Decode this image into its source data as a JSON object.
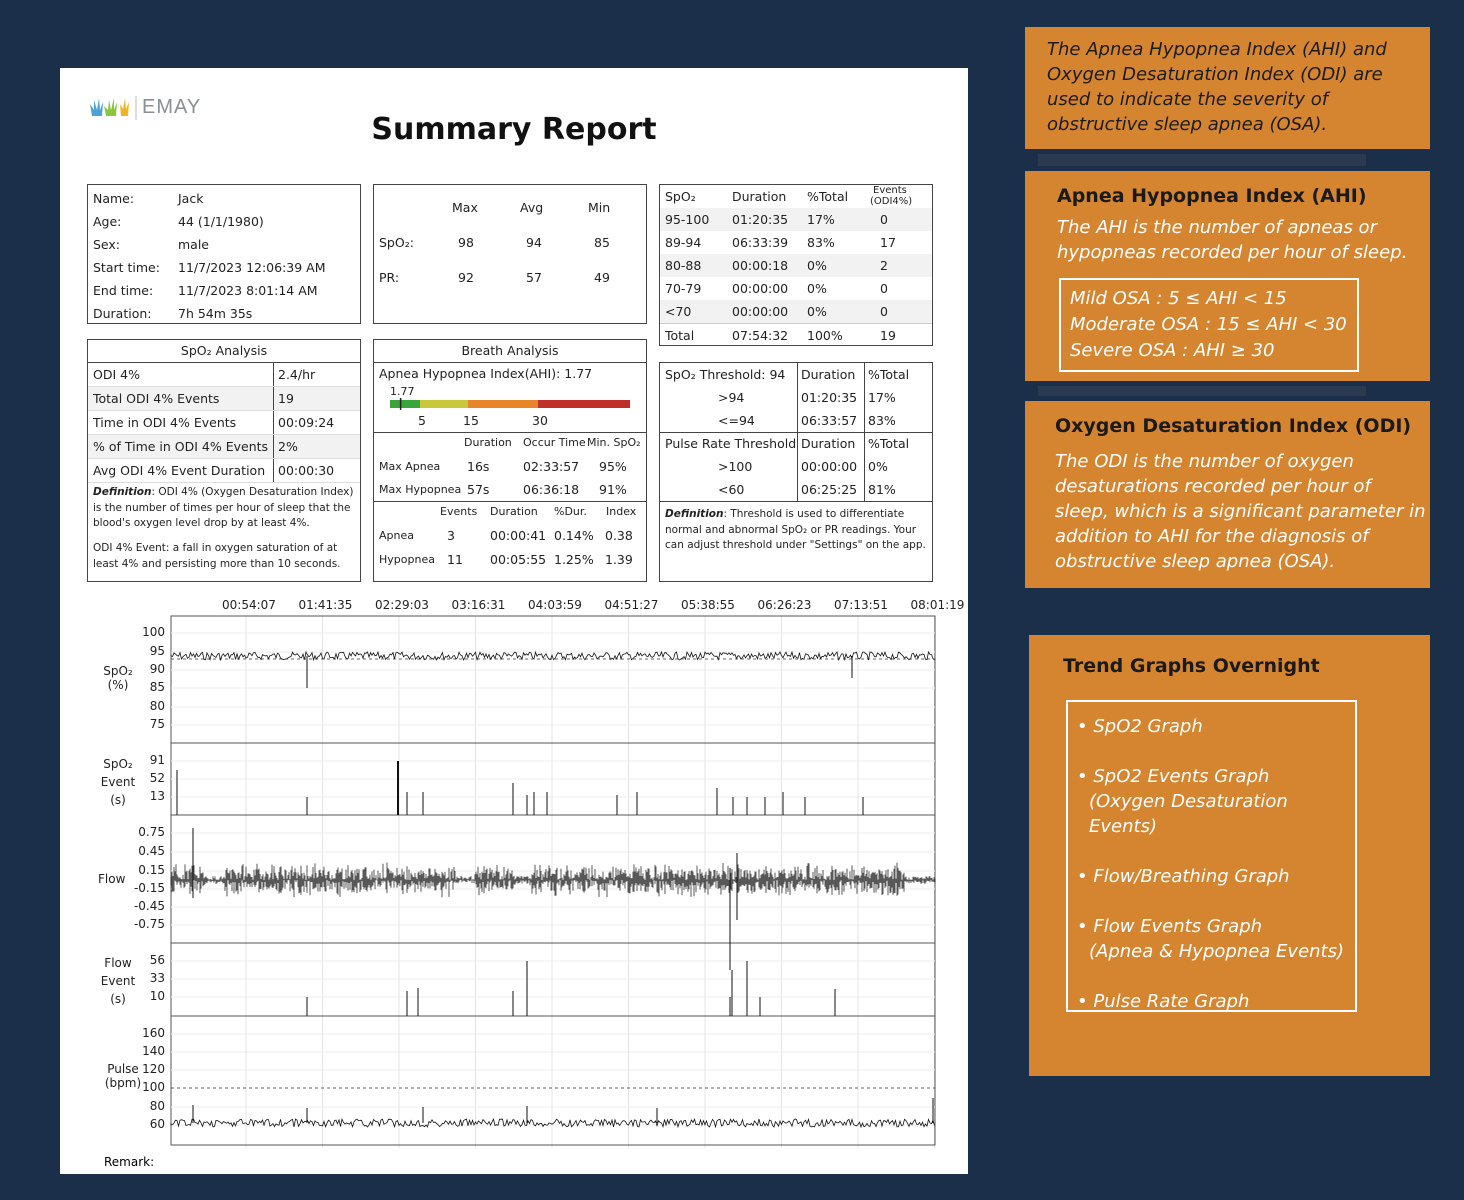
{
  "report": {
    "logo_text": "EMAY",
    "title": "Summary Report",
    "patient": [
      {
        "label": "Name:",
        "value": "Jack"
      },
      {
        "label": "Age:",
        "value": "44 (1/1/1980)"
      },
      {
        "label": "Sex:",
        "value": "male"
      },
      {
        "label": "Start time:",
        "value": "11/7/2023 12:06:39 AM"
      },
      {
        "label": "End time:",
        "value": "11/7/2023 8:01:14 AM"
      },
      {
        "label": "Duration:",
        "value": "7h 54m 35s"
      }
    ],
    "stats": {
      "headers": [
        "Max",
        "Avg",
        "Min"
      ],
      "spo2_label": "SpO₂:",
      "spo2": [
        "98",
        "94",
        "85"
      ],
      "pr_label": "PR:",
      "pr": [
        "92",
        "57",
        "49"
      ]
    },
    "ranges": {
      "headers": [
        "SpO₂",
        "Duration",
        "%Total",
        "Events",
        "(ODI4%)"
      ],
      "rows": [
        [
          "95-100",
          "01:20:35",
          "17%",
          "0"
        ],
        [
          "89-94",
          "06:33:39",
          "83%",
          "17"
        ],
        [
          "80-88",
          "00:00:18",
          "0%",
          "2"
        ],
        [
          "70-79",
          "00:00:00",
          "0%",
          "0"
        ],
        [
          "<70",
          "00:00:00",
          "0%",
          "0"
        ],
        [
          "Total",
          "07:54:32",
          "100%",
          "19"
        ]
      ]
    },
    "spo2_analysis": {
      "title": "SpO₂ Analysis",
      "rows": [
        [
          "ODI 4%",
          "2.4/hr"
        ],
        [
          "Total ODI 4% Events",
          "19"
        ],
        [
          "Time in ODI 4% Events",
          "00:09:24"
        ],
        [
          "% of Time in ODI 4% Events",
          "2%"
        ],
        [
          "Avg ODI 4% Event Duration",
          "00:00:30"
        ]
      ],
      "def_label": "Definition",
      "def_text": ": ODI 4% (Oxygen Desaturation Index) is the number of times per hour of sleep that the blood's oxygen level drop by at least 4%.",
      "event_text": "ODI 4% Event: a fall in oxygen saturation of at least 4% and persisting more than 10 seconds."
    },
    "breath_analysis": {
      "title": "Breath Analysis",
      "ahi_label": "Apnea Hypopnea Index(AHI): 1.77",
      "ahi_marker": "1.77",
      "ahi_value": 1.77,
      "scale_ticks": [
        "5",
        "15",
        "30"
      ],
      "max_headers": [
        "Duration",
        "Occur Time",
        "Min. SpO₂"
      ],
      "max_rows": [
        [
          "Max Apnea",
          "16s",
          "02:33:57",
          "95%"
        ],
        [
          "Max Hypopnea",
          "57s",
          "06:36:18",
          "91%"
        ]
      ],
      "ev_headers": [
        "Events",
        "Duration",
        "%Dur.",
        "Index"
      ],
      "ev_rows": [
        [
          "Apnea",
          "3",
          "00:00:41",
          "0.14%",
          "0.38"
        ],
        [
          "Hypopnea",
          "11",
          "00:05:55",
          "1.25%",
          "1.39"
        ]
      ]
    },
    "thresholds": {
      "spo2_header": [
        "SpO₂ Threshold: 94",
        "Duration",
        "%Total"
      ],
      "spo2_rows": [
        [
          ">94",
          "01:20:35",
          "17%"
        ],
        [
          "<=94",
          "06:33:57",
          "83%"
        ]
      ],
      "pr_header": [
        "Pulse Rate Threshold",
        "Duration",
        "%Total"
      ],
      "pr_rows": [
        [
          ">100",
          "00:00:00",
          "0%"
        ],
        [
          "<60",
          "06:25:25",
          "81%"
        ]
      ],
      "def_label": "Definition",
      "def_text": ": Threshold is used to differentiate normal and abnormal SpO₂ or PR readings. Your can adjust threshold under \"Settings\" on the app."
    },
    "graphs": {
      "time_ticks": [
        "00:54:07",
        "01:41:35",
        "02:29:03",
        "03:16:31",
        "04:03:59",
        "04:51:27",
        "05:38:55",
        "06:26:23",
        "07:13:51",
        "08:01:19"
      ],
      "spo2": {
        "label1": "SpO₂",
        "label2": "(%)",
        "ticks": [
          "100",
          "95",
          "90",
          "85",
          "80",
          "75"
        ]
      },
      "spo2_event": {
        "label1": "SpO₂",
        "label2": "Event",
        "label3": "(s)",
        "ticks": [
          "91",
          "52",
          "13"
        ]
      },
      "flow": {
        "label": "Flow",
        "ticks": [
          "0.75",
          "0.45",
          "0.15",
          "-0.15",
          "-0.45",
          "-0.75"
        ]
      },
      "flow_event": {
        "label1": "Flow",
        "label2": "Event",
        "label3": "(s)",
        "ticks": [
          "56",
          "33",
          "10"
        ]
      },
      "pulse": {
        "label1": "Pulse",
        "label2": "(bpm)",
        "ticks": [
          "160",
          "140",
          "120",
          "100",
          "80",
          "60"
        ]
      },
      "remark": "Remark:"
    }
  },
  "cards": {
    "intro": "The Apnea Hypopnea Index (AHI) and Oxygen Desaturation Index (ODI) are used to indicate the severity of obstructive sleep apnea (OSA).",
    "ahi_title": "Apnea Hypopnea Index (AHI)",
    "ahi_text": "The AHI is the number of apneas or hypopneas recorded per hour of sleep.",
    "ahi_levels": [
      "Mild OSA :   5 ≤ AHI < 15",
      "Moderate OSA :  15 ≤ AHI < 30",
      "Severe OSA : AHI ≥ 30"
    ],
    "odi_title": "Oxygen Desaturation Index (ODI)",
    "odi_text": "The ODI is the number of oxygen desaturations recorded per hour of sleep, which is a significant parameter in addition to AHI for the diagnosis of obstructive sleep apnea (OSA).",
    "trend_title": "Trend Graphs Overnight",
    "trend_items": [
      "• SpO2 Graph",
      "• SpO2 Events Graph",
      "(Oxygen Desaturation Events)",
      "• Flow/Breathing Graph",
      "• Flow Events Graph",
      "(Apnea & Hypopnea Events)",
      "• Pulse Rate Graph"
    ]
  },
  "colors": {
    "background": "#1b2f4a",
    "card": "#d58430",
    "scale_green": "#3aa53a",
    "scale_yellow": "#c8c83a",
    "scale_orange": "#e8852a",
    "scale_red": "#c0302a"
  }
}
